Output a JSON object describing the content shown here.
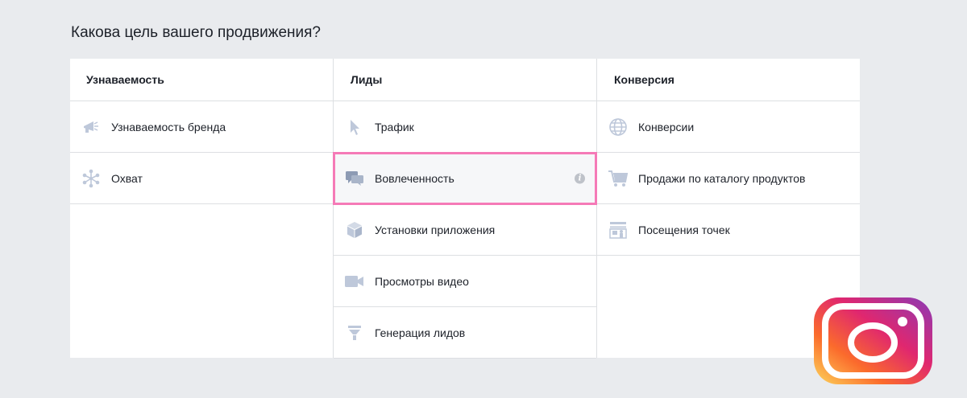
{
  "question": "Какова цель вашего продвижения?",
  "columns": [
    {
      "title": "Узнаваемость",
      "items": [
        {
          "label": "Узнаваемость бренда",
          "icon": "megaphone-icon"
        },
        {
          "label": "Охват",
          "icon": "reach-icon"
        }
      ]
    },
    {
      "title": "Лиды",
      "items": [
        {
          "label": "Трафик",
          "icon": "cursor-icon"
        },
        {
          "label": "Вовлеченность",
          "icon": "chat-bubbles-icon",
          "selected": true,
          "info": "i"
        },
        {
          "label": "Установки приложения",
          "icon": "box-icon"
        },
        {
          "label": "Просмотры видео",
          "icon": "video-camera-icon"
        },
        {
          "label": "Генерация лидов",
          "icon": "funnel-icon"
        }
      ]
    },
    {
      "title": "Конверсия",
      "items": [
        {
          "label": "Конверсии",
          "icon": "globe-icon"
        },
        {
          "label": "Продажи по каталогу продуктов",
          "icon": "cart-icon"
        },
        {
          "label": "Посещения точек",
          "icon": "store-icon"
        }
      ]
    }
  ],
  "colors": {
    "background": "#e9ebee",
    "selected_border": "#f57ab7",
    "icon": "#bec8da"
  }
}
